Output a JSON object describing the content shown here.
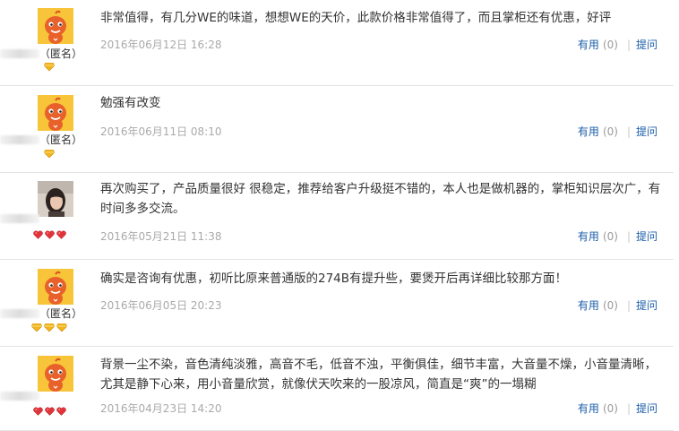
{
  "reviews": [
    {
      "avatar": "mascot-avatar",
      "name_suffix": "（匿名）",
      "level_icon": "gold-diamond-icon",
      "level_count": 1,
      "content": "非常值得，有几分WE的味道，想想WE的天价，此款价格非常值得了，而且掌柜还有优惠，好评",
      "date": "2016年06月12日 16:28",
      "useful_label": "有用",
      "useful_count": "(0)",
      "ask_label": "提问"
    },
    {
      "avatar": "mascot-avatar",
      "name_suffix": "（匿名）",
      "level_icon": "gold-diamond-icon",
      "level_count": 1,
      "content": "勉强有改变",
      "date": "2016年06月11日 08:10",
      "useful_label": "有用",
      "useful_count": "(0)",
      "ask_label": "提问"
    },
    {
      "avatar": "photo-avatar",
      "name_suffix": "",
      "level_icon": "red-heart-icon",
      "level_count": 3,
      "content": "再次购买了，产品质量很好 很稳定，推荐给客户升级挺不错的，本人也是做机器的，掌柜知识层次广，有时间多多交流。",
      "date": "2016年05月21日 11:38",
      "useful_label": "有用",
      "useful_count": "(0)",
      "ask_label": "提问"
    },
    {
      "avatar": "mascot-avatar",
      "name_suffix": "（匿名）",
      "level_icon": "gold-diamond-icon",
      "level_count": 3,
      "content": "确实是咨询有优惠，初听比原来普通版的274B有提升些，要煲开后再详细比较那方面！",
      "date": "2016年06月05日 20:23",
      "useful_label": "有用",
      "useful_count": "(0)",
      "ask_label": "提问"
    },
    {
      "avatar": "mascot-avatar",
      "name_suffix": "",
      "level_icon": "red-heart-icon",
      "level_count": 3,
      "content": "背景一尘不染，音色清纯淡雅，高音不毛，低音不浊，平衡俱佳，细节丰富，大音量不燥，小音量清晰，尤其是静下心来，用小音量欣赏，就像伏天吹来的一股凉风，简直是“爽”的一塌糊",
      "date": "2016年04月23日 14:20",
      "useful_label": "有用",
      "useful_count": "(0)",
      "ask_label": "提问"
    }
  ]
}
